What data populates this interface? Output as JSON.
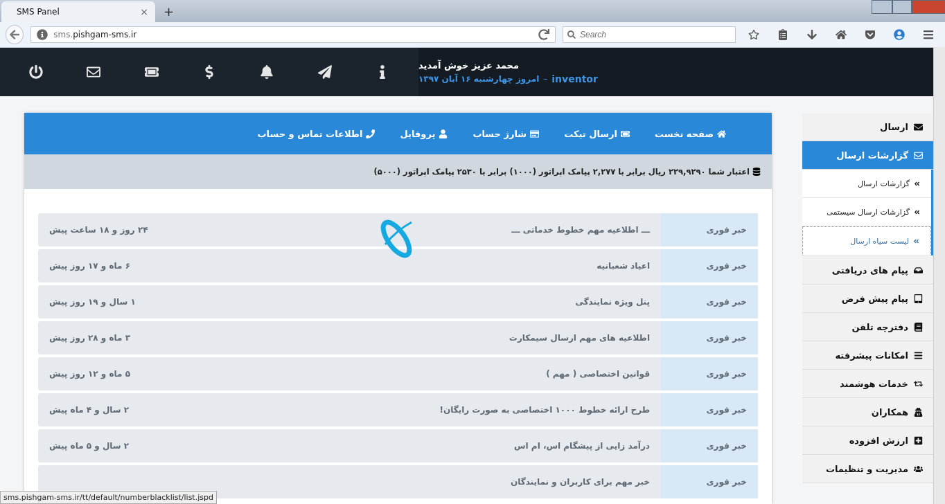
{
  "browser": {
    "tab": {
      "title": "SMS Panel",
      "close": "×",
      "new_tab": "+"
    },
    "address": {
      "host_prefix": "sms.",
      "host": "pishgam-sms.ir"
    },
    "search": {
      "placeholder": "Search"
    },
    "status_url": "sms.pishgam-sms.ir/tt/default/numberblacklist/list.jspd"
  },
  "header": {
    "greeting": "محمد عزیز خوش آمدید",
    "username": "inventor",
    "separator": "–",
    "date": "امروز چهارشنبه ۱۶ آبان ۱۳۹۷",
    "icons": [
      {
        "kind": "power"
      },
      {
        "kind": "mail"
      },
      {
        "kind": "ticket"
      },
      {
        "kind": "dollar"
      },
      {
        "kind": "bell"
      },
      {
        "kind": "send"
      },
      {
        "kind": "info"
      }
    ]
  },
  "nav": [
    {
      "kind": "home",
      "label": "صفحه نخست"
    },
    {
      "kind": "ticket",
      "label": "ارسال تیکت"
    },
    {
      "kind": "card",
      "label": "شارژ حساب"
    },
    {
      "kind": "user",
      "label": "پروفایل"
    },
    {
      "kind": "phone",
      "label": "اطلاعات تماس و حساب"
    }
  ],
  "credit": "اعتبار شما ۲۲۹,۹۲۹۰ ریال برابر با ۲,۲۷۷ پیامک اپراتور (۱۰۰۰) برابر با ۲۵۳۰ پیامک اپراتور (۵۰۰۰)",
  "loading": true,
  "news": [
    {
      "tag": "خبر فوری",
      "title": "ـــ اطلاعیه مهم خطوط خدماتی ـــ",
      "time": "۲۴ روز و ۱۸ ساعت پیش"
    },
    {
      "tag": "خبر فوری",
      "title": "اعیاد شعبانیه",
      "time": "۶ ماه و ۱۷ روز پیش"
    },
    {
      "tag": "خبر فوری",
      "title": "پنل ویژه نمایندگی",
      "time": "۱ سال و ۱۹ روز پیش"
    },
    {
      "tag": "خبر فوری",
      "title": "اطلاعیه های مهم ارسال سیمکارت",
      "time": "۳ ماه و ۲۸ روز پیش"
    },
    {
      "tag": "خبر فوری",
      "title": "قوانین اختصاصی ( مهم )",
      "time": "۵ ماه و ۱۲ روز پیش"
    },
    {
      "tag": "خبر فوری",
      "title": "طرح ارائه خطوط ۱۰۰۰ اختصاصی به صورت رایگان!",
      "time": "۲ سال و ۴ ماه پیش"
    },
    {
      "tag": "خبر فوری",
      "title": "درآمد زایی از پیشگام اس، ام اس",
      "time": "۲ سال و ۵ ماه پیش"
    },
    {
      "tag": "خبر فوری",
      "title": "خبر مهم برای کاربران و نمایندگان"
    }
  ],
  "sidebar": [
    {
      "kind": "send",
      "label": "ارسال",
      "selected": false
    },
    {
      "kind": "mail",
      "label": "گزارشات ارسال",
      "selected": true,
      "expanded": true,
      "children": [
        {
          "label": "گزارشات ارسال",
          "selected": false
        },
        {
          "label": "گزارشات ارسال سیستمی",
          "selected": false
        },
        {
          "label": "لیست سیاه ارسال",
          "selected": true
        }
      ]
    },
    {
      "kind": "inbox",
      "label": "پیام های دریافتی",
      "selected": false
    },
    {
      "kind": "tablet",
      "label": "پیام پیش فرض",
      "selected": false
    },
    {
      "kind": "book",
      "label": "دفترچه تلفن",
      "selected": false
    },
    {
      "kind": "list",
      "label": "امکانات پیشرفته",
      "selected": false
    },
    {
      "kind": "retweet",
      "label": "خدمات هوشمند",
      "selected": false
    },
    {
      "kind": "agent",
      "label": "همکاران",
      "selected": false
    },
    {
      "kind": "plus",
      "label": "ارزش افزوده",
      "selected": false
    },
    {
      "kind": "users",
      "label": "مدیریت و تنظیمات",
      "selected": false
    }
  ]
}
